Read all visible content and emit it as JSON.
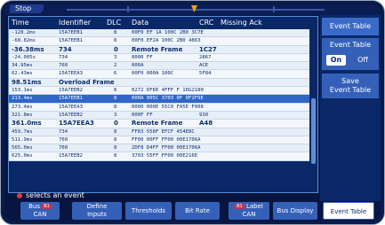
{
  "top": {
    "status": "Stop"
  },
  "table": {
    "headers": {
      "time": "Time",
      "identifier": "Identifier",
      "dlc": "DLC",
      "data": "Data",
      "crc": "CRC",
      "missing_ack": "Missing Ack"
    },
    "rows": [
      {
        "time": "-128.2ms",
        "id": "15A7EEB1",
        "dlc": "8",
        "data": "00F0 EF 1A 100C 2B0 3C7E",
        "crc": "",
        "type": "data"
      },
      {
        "time": "-68.82ms",
        "id": "15A7EEB1",
        "dlc": "8",
        "data": "00F0 EF2A 100C 2B0 4863",
        "crc": "",
        "type": "data"
      },
      {
        "time": "-36.38ms",
        "id": "734",
        "dlc": "0",
        "data": "Remote Frame",
        "crc": "1C27",
        "type": "remote"
      },
      {
        "time": "-24.005s",
        "id": "734",
        "dlc": "3",
        "data": "0000 FF",
        "crc": "2867",
        "type": "data"
      },
      {
        "time": "34.95ms",
        "id": "760",
        "dlc": "2",
        "data": "000A",
        "crc": "ACE",
        "type": "data"
      },
      {
        "time": "62.43ms",
        "id": "15A7EEA3",
        "dlc": "6",
        "data": "00F0 000A 100C",
        "crc": "5F84",
        "type": "data"
      },
      {
        "time": "98.51ms",
        "id": "Overload Frame",
        "dlc": "",
        "data": "",
        "crc": "",
        "type": "overload"
      },
      {
        "time": "153.1ms",
        "id": "15A7EEB2",
        "dlc": "8",
        "data": "0272 DF6E 4FFF F 1DG2180",
        "crc": "",
        "type": "data"
      },
      {
        "time": "213.4ms",
        "id": "15A7EEB1",
        "dlc": "8",
        "data": "000A 005C 3703 0F 0F2F9E",
        "crc": "",
        "type": "selected"
      },
      {
        "time": "273.4ms",
        "id": "15A7EEA3",
        "dlc": "8",
        "data": "0000 000E 55C0 FA5E F008",
        "crc": "",
        "type": "data"
      },
      {
        "time": "321.8ms",
        "id": "15A7EEB2",
        "dlc": "3",
        "data": "000F FF",
        "crc": "930",
        "type": "data"
      },
      {
        "time": "361.0ms",
        "id": "15A7EEA3",
        "dlc": "0",
        "data": "Remote Frame",
        "crc": "A48",
        "type": "remote"
      },
      {
        "time": "459.7ms",
        "id": "734",
        "dlc": "8",
        "data": "FF83 558F EFCF 454E8C",
        "crc": "",
        "type": "data"
      },
      {
        "time": "511.9ms",
        "id": "760",
        "dlc": "8",
        "data": "FF00 00FF FF00 00E1706A",
        "crc": "",
        "type": "data"
      },
      {
        "time": "565.0ms",
        "id": "760",
        "dlc": "8",
        "data": "2DF8 D4FF FF00 00E1706A",
        "crc": "",
        "type": "data"
      },
      {
        "time": "625.0ms",
        "id": "15A7EEB2",
        "dlc": "8",
        "data": "3703 55FF FF00 00E216E",
        "crc": "",
        "type": "data"
      }
    ]
  },
  "hint": {
    "text": "selects an event"
  },
  "side_panel": {
    "title": "Event Table",
    "event_table_label": "Event Table",
    "on_label": "On",
    "off_label": "Off",
    "save_label_line1": "Save",
    "save_label_line2": "Event Table"
  },
  "softkeys": {
    "bus_line1": "Bus",
    "bus_chip": "B1",
    "bus_line2": "CAN",
    "define_line1": "Define",
    "define_line2": "Inputs",
    "thresholds": "Thresholds",
    "bit_rate": "Bit Rate",
    "label_chip": "B1",
    "label_line1": "Label",
    "label_line2": "CAN",
    "bus_display": "Bus Display",
    "event_table": "Event Table"
  },
  "colors": {
    "accent": "#3560b8",
    "selected_row": "#2f66c8",
    "trigger": "#f0a000",
    "bus_badge": "#c8364a"
  }
}
